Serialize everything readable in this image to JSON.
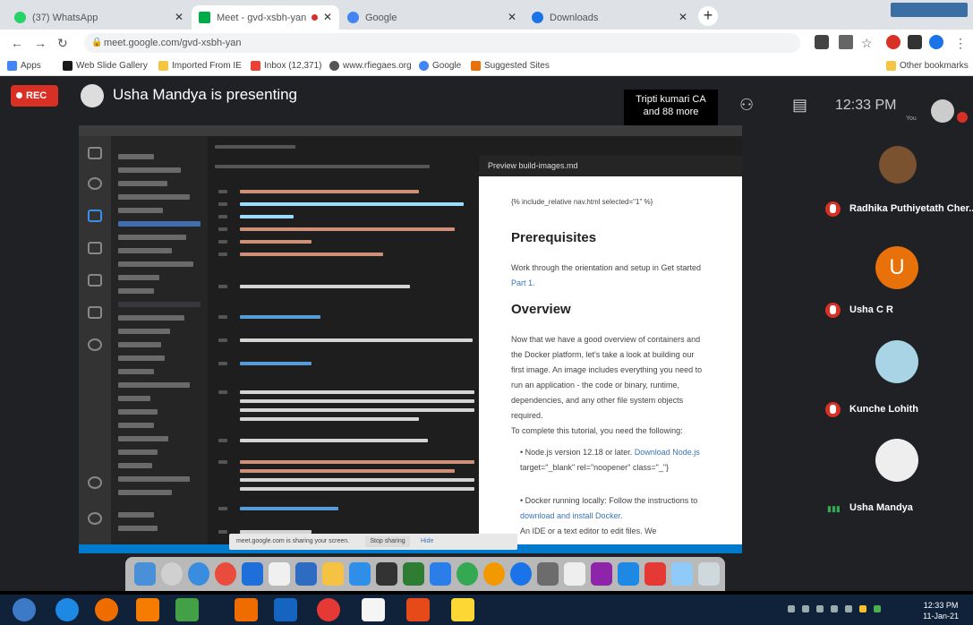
{
  "browser": {
    "tabs": [
      {
        "label": "(37) WhatsApp",
        "favicon": "whatsapp-icon",
        "color": "#25d366",
        "active": false
      },
      {
        "label": "Meet - gvd-xsbh-yan",
        "favicon": "meet-icon",
        "color": "#00ac47",
        "active": true
      },
      {
        "label": "Google",
        "favicon": "google-icon",
        "color": "#4285f4",
        "active": false
      },
      {
        "label": "Downloads",
        "favicon": "download-icon",
        "color": "#1a73e8",
        "active": false
      }
    ],
    "address": "meet.google.com/gvd-xsbh-yan",
    "bookmarks": [
      {
        "label": "Apps",
        "color": "#4285f4"
      },
      {
        "label": "Web Slide Gallery",
        "color": "#1a1a1a"
      },
      {
        "label": "Imported From IE",
        "color": "#f4c542"
      },
      {
        "label": "Inbox (12,371)",
        "color": "#ea4335"
      },
      {
        "label": "www.rfiegaes.org",
        "color": "#555"
      },
      {
        "label": "Google",
        "color": "#4285f4"
      },
      {
        "label": "Suggested Sites",
        "color": "#e8710a"
      }
    ],
    "other_bookmarks": "Other bookmarks"
  },
  "meet": {
    "rec_label": "REC",
    "presenting_text": "Usha Mandya is presenting",
    "raised_hand_note": "Tripti kumari CA and 88 more",
    "time": "12:33 PM",
    "you_label": "You",
    "participants": [
      {
        "name": "Radhika Puthiyetath Cher...",
        "avatar": "photo",
        "color": "#7a5230"
      },
      {
        "name": "Usha C R",
        "avatar": "U",
        "color": "#e8710a"
      },
      {
        "name": "Kunche Lohith",
        "avatar": "photo",
        "color": "#a8d4e6"
      },
      {
        "name": "Usha Mandya",
        "avatar": "photo",
        "color": "#eeeeee"
      }
    ]
  },
  "screen_share": {
    "preview_tab": "Preview build-images.md",
    "preview_include": "{% include_relative nav.html selected=\"1\" %}",
    "prerequisites_heading": "Prerequisites",
    "prerequisites_text": "Work through the orientation and setup in Get started",
    "prerequisites_link": "Part 1.",
    "overview_heading": "Overview",
    "overview_text": "Now that we have a good overview of containers and the Docker platform, let's take a look at building our first image. An image includes everything you need to run an application - the code or binary, runtime, dependencies, and any other file system objects required.",
    "complete_text": "To complete this tutorial, you need the following:",
    "bullets": [
      {
        "prefix": "Node.js version 12.18 or later.",
        "link": "Download Node.js",
        "suffix": "target=\"_blank\" rel=\"noopener\" class=\"_\"}"
      },
      {
        "prefix": "Docker running locally: Follow the instructions to",
        "link": "download and install Docker.",
        "suffix": ""
      }
    ],
    "ide_text": "An IDE or a text editor to edit files. We",
    "notification_text": "meet.google.com is sharing your screen.",
    "stop_sharing": "Stop sharing",
    "hide": "Hide"
  },
  "taskbar": {
    "time": "12:33 PM",
    "date": "11-Jan-21"
  }
}
